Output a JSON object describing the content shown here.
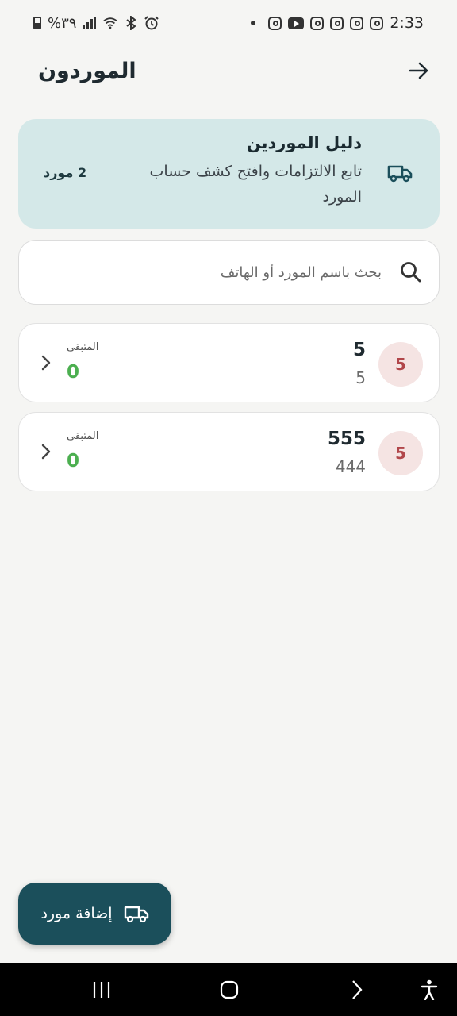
{
  "status_bar": {
    "battery_text": "%٣٩",
    "time": "2:33",
    "icons": [
      "battery-icon",
      "signal-icon",
      "wifi-icon",
      "bluetooth-icon",
      "alarm-icon",
      "dot-icon",
      "instagram-icon",
      "youtube-icon",
      "instagram-icon",
      "instagram-icon",
      "instagram-icon",
      "instagram-icon"
    ]
  },
  "header": {
    "title": "الموردون",
    "back_icon": "arrow-right-icon"
  },
  "info_card": {
    "title": "دليل الموردين",
    "description": "تابع الالتزامات وافتح كشف حساب المورد",
    "count": "2 مورد",
    "icon": "truck-icon",
    "background": "#d4e8e8"
  },
  "search": {
    "placeholder": "بحث باسم المورد أو الهاتف",
    "value": ""
  },
  "suppliers": [
    {
      "badge": "5",
      "name": "5",
      "phone": "5",
      "remaining_label": "المتبقي",
      "remaining_value": "0"
    },
    {
      "badge": "5",
      "name": "555",
      "phone": "444",
      "remaining_label": "المتبقي",
      "remaining_value": "0"
    }
  ],
  "fab": {
    "label": "إضافة مورد",
    "icon": "truck-icon",
    "color": "#1b4f5b"
  },
  "colors": {
    "accent": "#1b4f5b",
    "positive": "#4caf50",
    "badge_text": "#b1464a",
    "badge_bg": "#f5e4e3"
  },
  "nav_bar": {
    "buttons": [
      "recent-apps-icon",
      "home-icon",
      "back-icon",
      "accessibility-icon"
    ]
  }
}
